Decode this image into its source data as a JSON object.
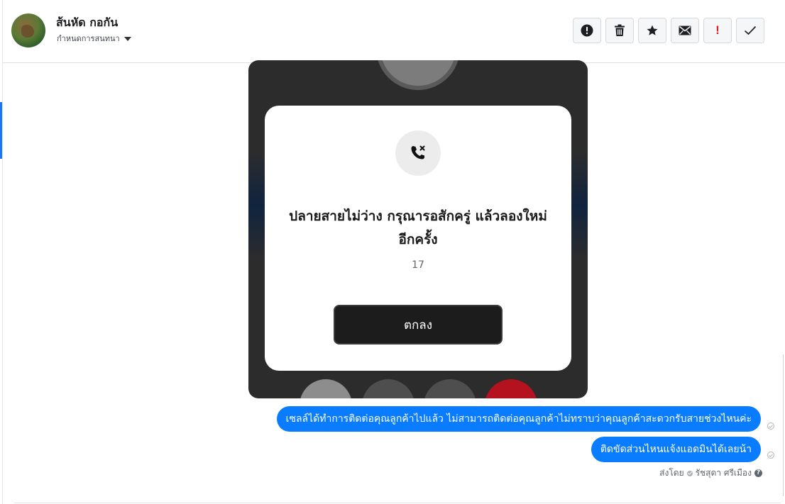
{
  "header": {
    "contact_name": "ส้นหัด กอกัน",
    "assign_label": "กำหนดการสนทนา",
    "actions": [
      {
        "name": "report-button",
        "icon": "alert-circle-icon"
      },
      {
        "name": "delete-button",
        "icon": "trash-icon"
      },
      {
        "name": "star-button",
        "icon": "star-icon"
      },
      {
        "name": "mark-unread-button",
        "icon": "envelope-icon"
      },
      {
        "name": "important-button",
        "icon": "exclamation-icon",
        "label": "!",
        "color": "#e02020"
      },
      {
        "name": "done-button",
        "icon": "check-icon"
      }
    ]
  },
  "attachment": {
    "dialog_title_line1": "ปลายสายไม่ว่าง กรุณารอสักครู่ แล้วลองใหม่",
    "dialog_title_line2": "อีกครั้ง",
    "dialog_number": "17",
    "ok_label": "ตกลง"
  },
  "messages": [
    {
      "text": "เซลล์ได้ทำการติดต่อคุณลูกค้าไปแล้ว ไม่สามารถติดต่อคุณลูกค้าไม่ทราบว่าคุณลูกค้าสะดวกรับสายช่วงไหนค่ะ"
    },
    {
      "text": "ติดขัดส่วนไหนแจ้งแอดมินได้เลยน้า"
    }
  ],
  "sent_by": {
    "label": "ส่งโดย",
    "agent": "รัชสุดา ศรีเมือง"
  },
  "colors": {
    "bubble": "#0a7cff",
    "accent": "#1877f2",
    "important": "#e02020"
  }
}
